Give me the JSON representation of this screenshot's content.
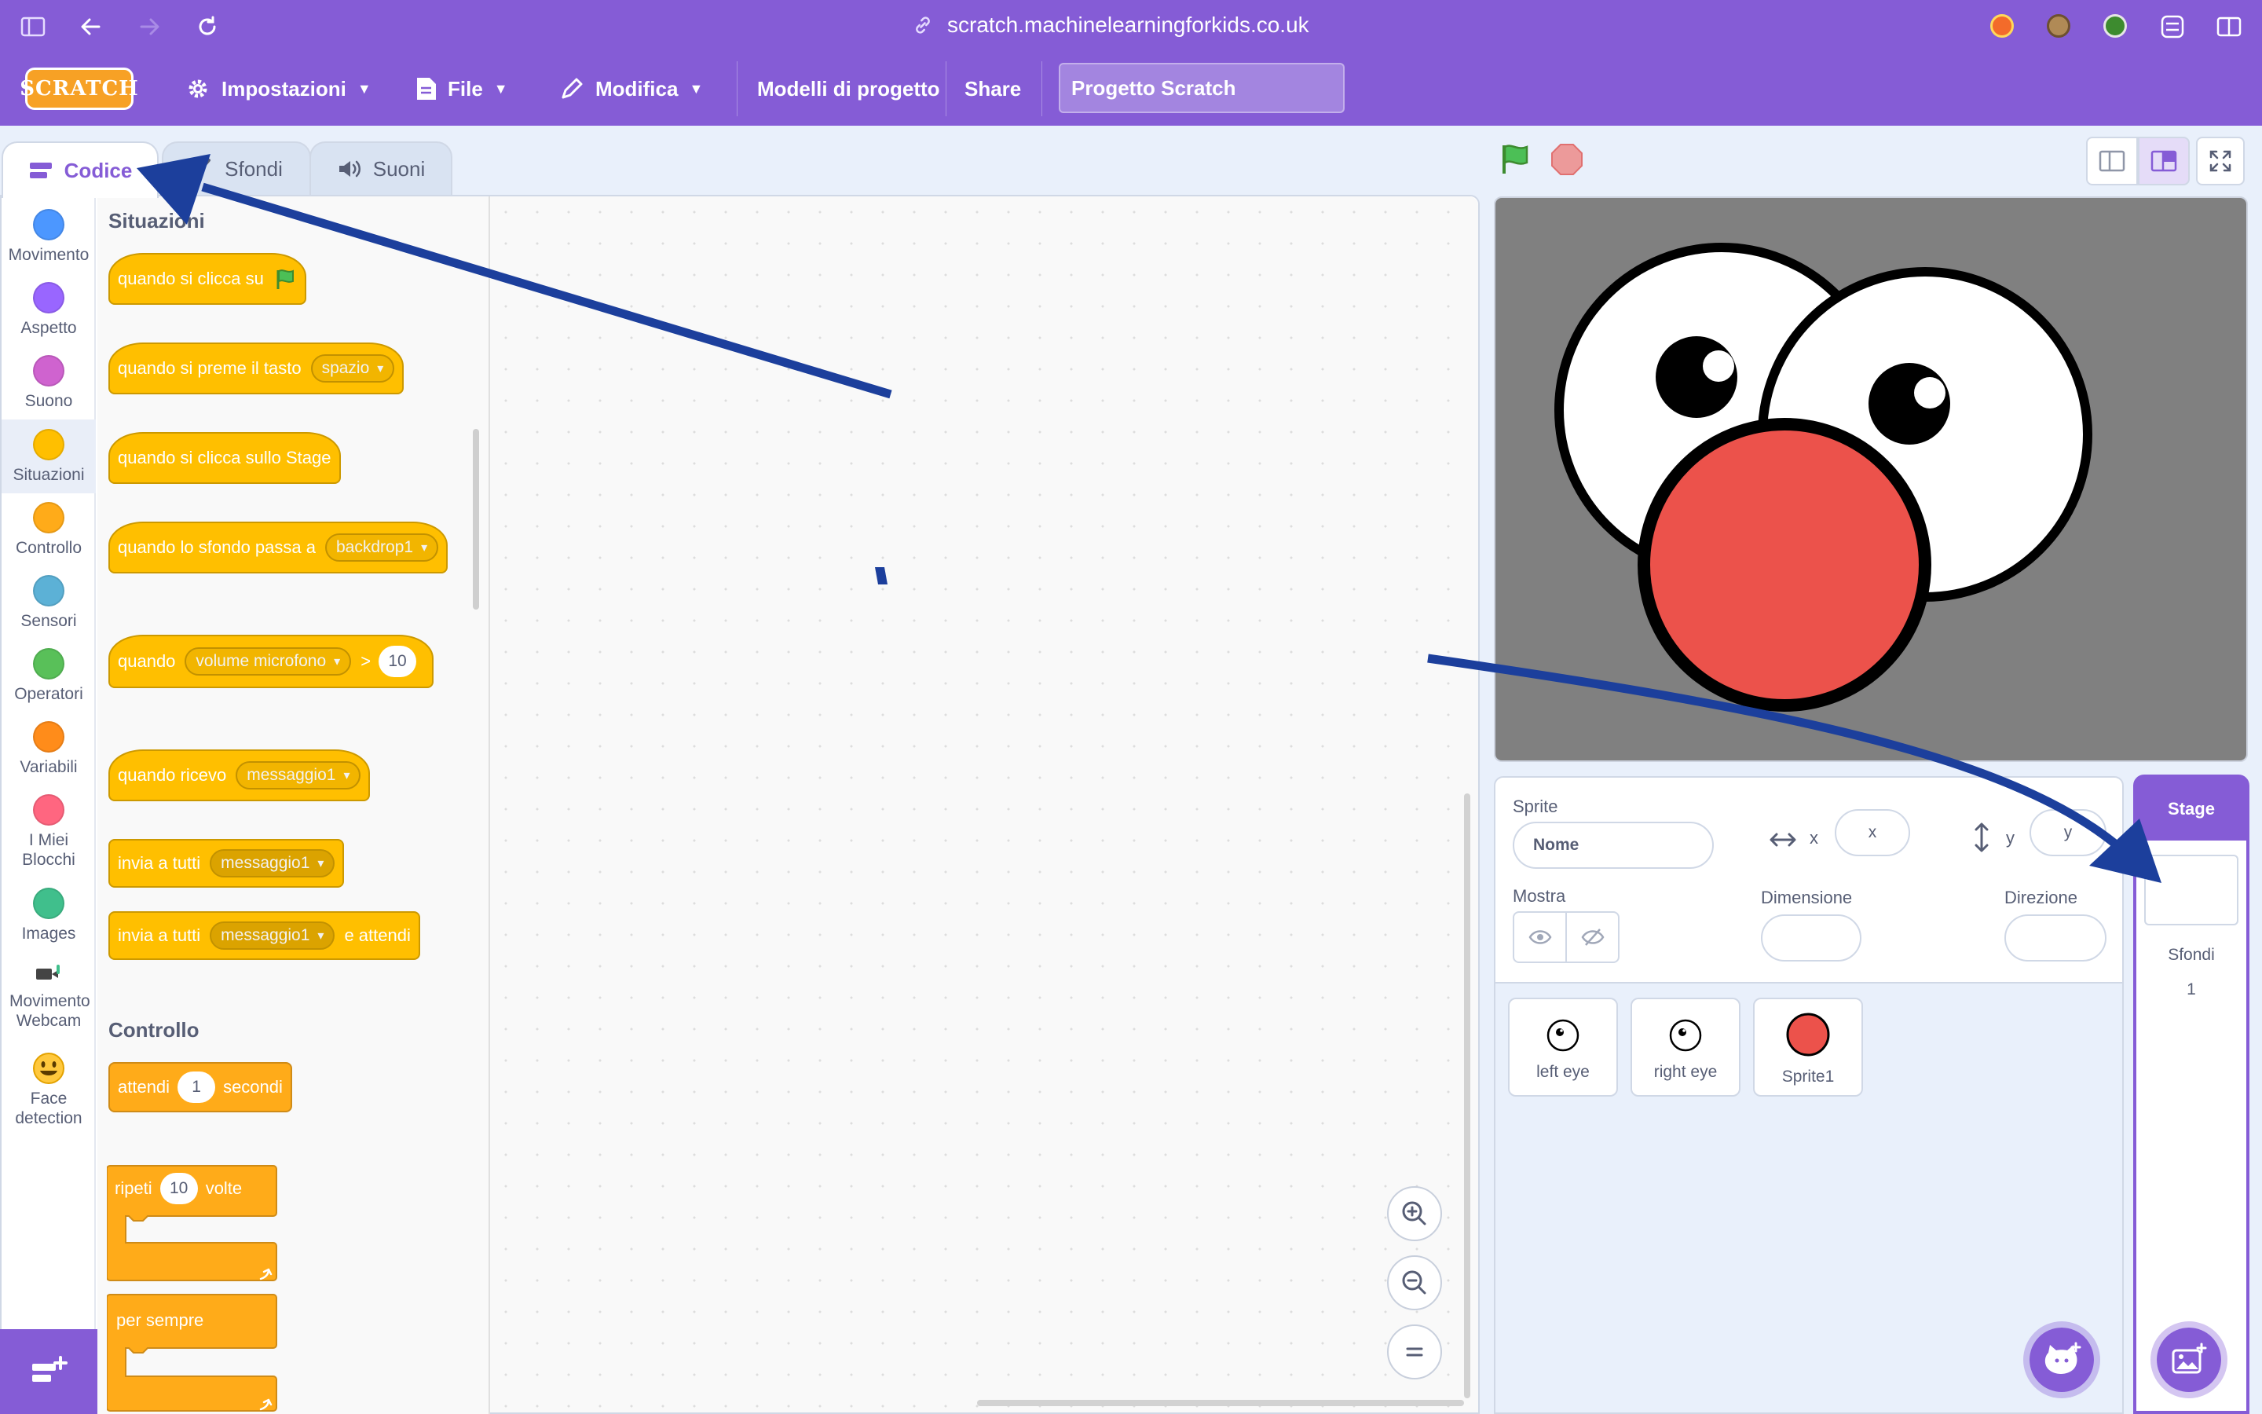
{
  "browser": {
    "url": "scratch.machinelearningforkids.co.uk"
  },
  "menu": {
    "logo_text": "SCRATCH",
    "settings": "Impostazioni",
    "file": "File",
    "edit": "Modifica",
    "templates": "Modelli di progetto",
    "share": "Share",
    "project_title": "Progetto Scratch"
  },
  "tabs": [
    {
      "label": "Codice"
    },
    {
      "label": "Sfondi"
    },
    {
      "label": "Suoni"
    }
  ],
  "categories": [
    {
      "label": "Movimento",
      "color": "#4c97ff"
    },
    {
      "label": "Aspetto",
      "color": "#9966ff"
    },
    {
      "label": "Suono",
      "color": "#cf63cf"
    },
    {
      "label": "Situazioni",
      "color": "#ffbf00"
    },
    {
      "label": "Controllo",
      "color": "#ffab19"
    },
    {
      "label": "Sensori",
      "color": "#5cb1d6"
    },
    {
      "label": "Operatori",
      "color": "#59c059"
    },
    {
      "label": "Variabili",
      "color": "#ff8c1a"
    },
    {
      "label": "I Miei Blocchi",
      "color": "#ff6680"
    },
    {
      "label": "Images",
      "color": "#40bf8c"
    },
    {
      "label": "Movimento Webcam",
      "icon": "webcam-icon"
    },
    {
      "label": "Face detection",
      "icon": "smiley-icon"
    }
  ],
  "palette": {
    "events_header": "Situazioni",
    "control_header": "Controllo",
    "blocks": {
      "flag_clicked": "quando si clicca su",
      "key_pressed": "quando si preme il tasto",
      "key_value": "spazio",
      "stage_clicked": "quando si clicca sullo Stage",
      "backdrop_switch": "quando lo sfondo passa a",
      "backdrop_value": "backdrop1",
      "when": "quando",
      "sensor_value": "volume microfono",
      "gt": ">",
      "threshold": "10",
      "receive": "quando ricevo",
      "message": "messaggio1",
      "broadcast": "invia a tutti",
      "broadcast_wait_suffix": "e attendi",
      "wait": "attendi",
      "wait_value": "1",
      "seconds": "secondi",
      "repeat": "ripeti",
      "repeat_value": "10",
      "times": "volte",
      "forever": "per sempre"
    }
  },
  "sprite_info": {
    "sprite_label": "Sprite",
    "name_placeholder": "Nome",
    "x_label": "x",
    "x_placeholder": "x",
    "y_label": "y",
    "y_placeholder": "y",
    "show_label": "Mostra",
    "size_label": "Dimensione",
    "direction_label": "Direzione"
  },
  "sprites": [
    {
      "name": "left eye"
    },
    {
      "name": "right eye"
    },
    {
      "name": "Sprite1"
    }
  ],
  "stage_selector": {
    "title": "Stage",
    "backdrops_label": "Sfondi",
    "backdrops_count": "1"
  },
  "colors": {
    "accent": "#855cd6",
    "events": "#ffbf00",
    "control": "#ffab19",
    "annotation_arrow": "#1c3f9c",
    "nose": "#ec524b"
  }
}
